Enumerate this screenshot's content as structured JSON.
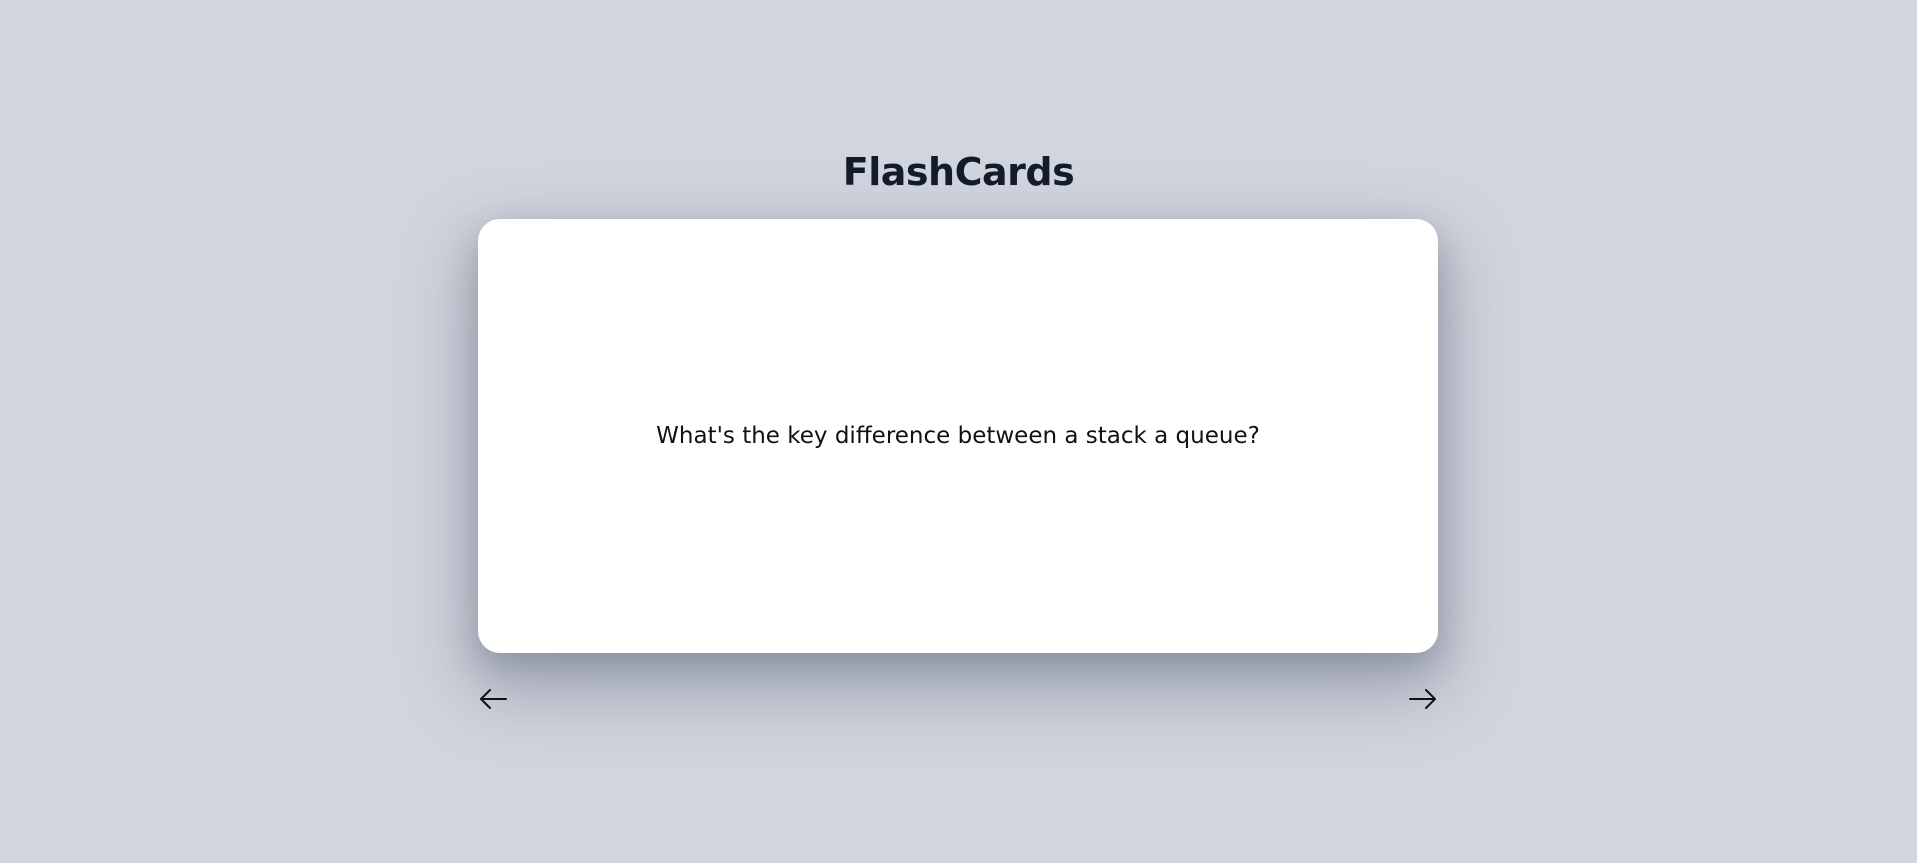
{
  "app": {
    "title": "FlashCards"
  },
  "card": {
    "text": "What's the key difference between a stack a queue?"
  },
  "navigation": {
    "prev_icon": "arrow-left-icon",
    "next_icon": "arrow-right-icon"
  },
  "colors": {
    "background": "#d1d5de",
    "card": "#ffffff",
    "title": "#141b2b"
  }
}
